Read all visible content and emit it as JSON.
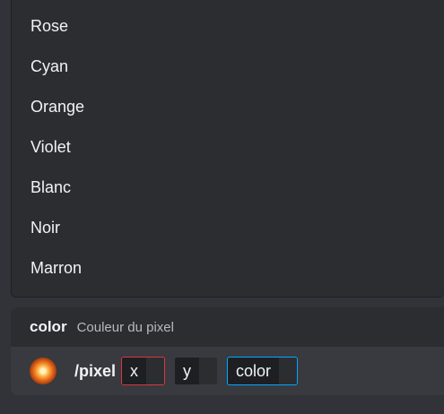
{
  "autocomplete": {
    "options": [
      "Rose",
      "Cyan",
      "Orange",
      "Violet",
      "Blanc",
      "Noir",
      "Marron"
    ]
  },
  "option_hint": {
    "name": "color",
    "description": "Couleur du pixel"
  },
  "composer": {
    "command": "/pixel",
    "params": [
      {
        "name": "x",
        "state": "error"
      },
      {
        "name": "y",
        "state": "normal"
      },
      {
        "name": "color",
        "state": "active"
      }
    ]
  },
  "colors": {
    "error_border": "#da373c",
    "active_border": "#00a8fc"
  }
}
